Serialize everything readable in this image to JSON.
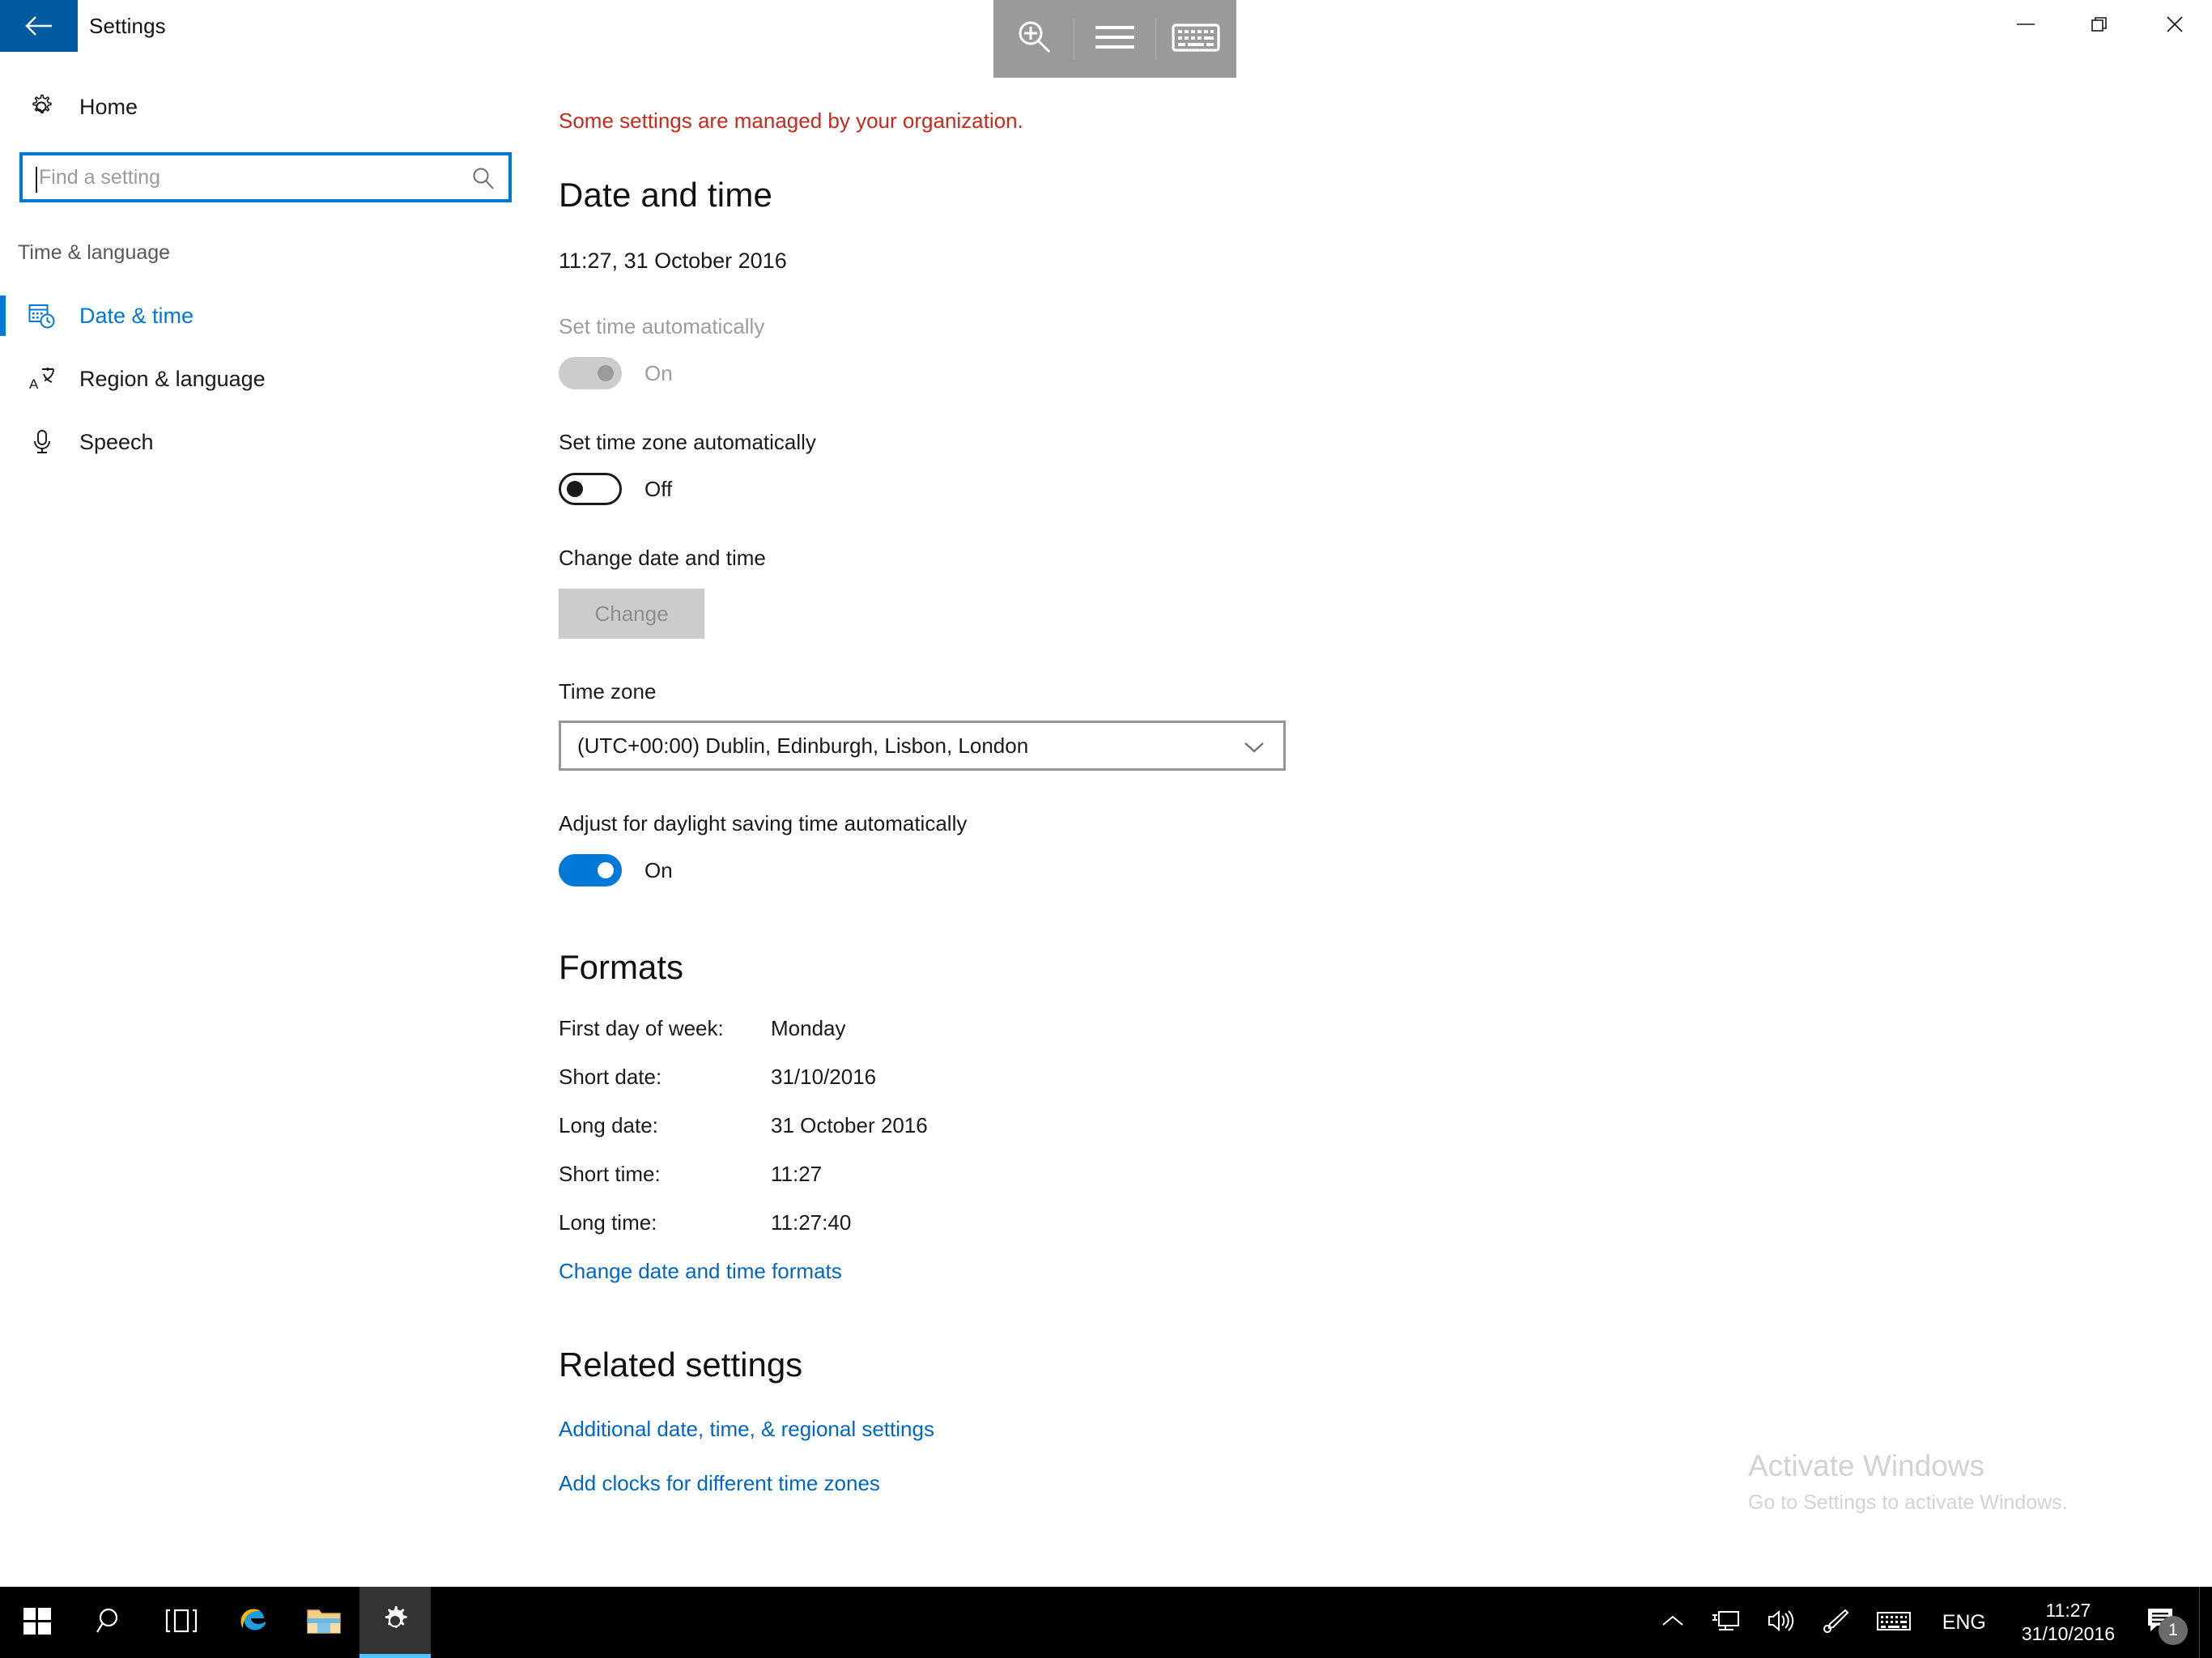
{
  "window": {
    "title": "Settings",
    "back_icon": "back-arrow-icon",
    "minimize_label": "Minimize",
    "maximize_label": "Restore",
    "close_label": "Close"
  },
  "access_toolbar": {
    "magnifier_label": "Magnifier",
    "menu_label": "Menu",
    "keyboard_label": "On-screen keyboard"
  },
  "sidebar": {
    "home_label": "Home",
    "home_icon": "gear-icon",
    "search": {
      "placeholder": "Find a setting",
      "value": "",
      "icon": "search-icon"
    },
    "category_label": "Time & language",
    "items": [
      {
        "label": "Date & time",
        "icon": "calendar-clock-icon",
        "selected": true
      },
      {
        "label": "Region & language",
        "icon": "language-icon",
        "selected": false
      },
      {
        "label": "Speech",
        "icon": "microphone-icon",
        "selected": false
      }
    ]
  },
  "main": {
    "managed_notice": "Some settings are managed by your organization.",
    "managed_notice_color": "#c42b1c",
    "heading": "Date and time",
    "current_datetime": "11:27, 31 October 2016",
    "set_time_auto": {
      "label": "Set time automatically",
      "state": "On",
      "disabled": true
    },
    "set_timezone_auto": {
      "label": "Set time zone automatically",
      "state": "Off",
      "disabled": false
    },
    "change_datetime": {
      "label": "Change date and time",
      "button_label": "Change",
      "disabled": true
    },
    "timezone": {
      "label": "Time zone",
      "value": "(UTC+00:00) Dublin, Edinburgh, Lisbon, London",
      "chevron_icon": "chevron-down-icon"
    },
    "dst": {
      "label": "Adjust for daylight saving time automatically",
      "state": "On",
      "disabled": false
    },
    "formats": {
      "heading": "Formats",
      "rows": [
        {
          "key": "First day of week:",
          "value": "Monday"
        },
        {
          "key": "Short date:",
          "value": "31/10/2016"
        },
        {
          "key": "Long date:",
          "value": "31 October 2016"
        },
        {
          "key": "Short time:",
          "value": "11:27"
        },
        {
          "key": "Long time:",
          "value": "11:27:40"
        }
      ],
      "link": "Change date and time formats"
    },
    "related": {
      "heading": "Related settings",
      "links": [
        "Additional date, time, & regional settings",
        "Add clocks for different time zones"
      ]
    }
  },
  "watermark": {
    "title": "Activate Windows",
    "subtitle": "Go to Settings to activate Windows."
  },
  "taskbar": {
    "start_label": "Start",
    "search_label": "Search",
    "taskview_label": "Task View",
    "edge_label": "Microsoft Edge",
    "explorer_label": "File Explorer",
    "settings_label": "Settings",
    "tray": {
      "chevron_label": "Show hidden icons",
      "network_label": "Network",
      "volume_label": "Volume",
      "pen_label": "Windows Ink Workspace",
      "keyboard_label": "Touch keyboard",
      "language": "ENG",
      "time": "11:27",
      "date": "31/10/2016",
      "action_center_label": "Action Center",
      "action_center_badge": "1"
    }
  },
  "colors": {
    "accent": "#0078d7",
    "back_button_bg": "#005ba1",
    "link": "#0067c0",
    "error": "#c42b1c",
    "taskbar_bg": "#000000"
  }
}
